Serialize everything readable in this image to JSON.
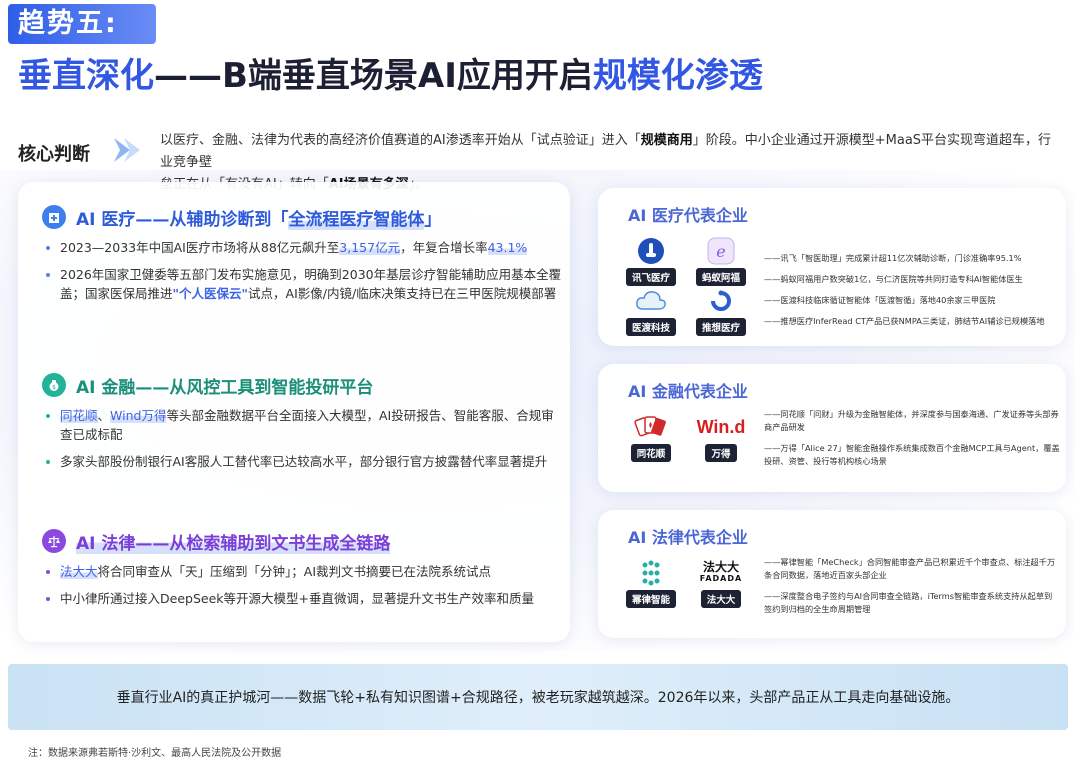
{
  "badge": "趋势五:",
  "headline": {
    "part1": "垂直深化",
    "part2": "——B端垂直场景AI应用开启",
    "part3": "规模化渗透"
  },
  "core": {
    "label": "核心判断",
    "line1_a": "以医疗、金融、法律为代表的高经济价值赛道的AI渗透率开始从「试点验证」进入「",
    "line1_b": "规模商用",
    "line1_c": "」阶段。中小企业通过开源模型+MaaS平台实现弯道超车，行业竞争壁",
    "line2_a": "垒正在从「有没有AI」转向「",
    "line2_b": "AI场景有多深",
    "line2_c": "」。"
  },
  "medical": {
    "title_a": "AI 医疗——从辅助诊断到「",
    "title_b": "全流程医疗智能体",
    "title_c": "」",
    "b1_a": "2023—2033年中国AI医疗市场将从88亿元飙升至",
    "b1_b": "3,157亿元",
    "b1_c": "，年复合增长率",
    "b1_d": "43.1%",
    "b2_a": "2026年国家卫健委等五部门发布实施意见，明确到2030年基层诊疗智能辅助应用基本全覆盖；国家医保局推进",
    "b2_b": "\"个人医保云\"",
    "b2_c": "试点，AI影像/内镜/临床决策支持已在三甲医院规模部署"
  },
  "finance": {
    "title": "AI 金融——从风控工具到智能投研平台",
    "b1_a": "同花顺",
    "b1_sep": "、",
    "b1_b": "Wind万得",
    "b1_c": "等头部金融数据平台全面接入大模型，AI投研报告、智能客服、合规审查已成标配",
    "b2": "多家头部股份制银行AI客服人工替代率已达较高水平，部分银行官方披露替代率显著提升"
  },
  "legal": {
    "title": "AI 法律——从检索辅助到文书生成全链路",
    "b1_a": "法大大",
    "b1_b": "将合同审查从「天」压缩到「分钟」；AI裁判文书摘要已在法院系统试点",
    "b2": "中小律所通过接入DeepSeek等开源大模型+垂直微调，显著提升文书生产效率和质量"
  },
  "medical_companies": {
    "title": "AI 医疗代表企业",
    "logos": [
      "讯飞医疗",
      "蚂蚁阿福",
      "医渡科技",
      "推想医疗"
    ],
    "lines": [
      "——讯飞「智医助理」完成累计超11亿次辅助诊断，门诊准确率95.1%",
      "——蚂蚁阿福用户数突破1亿，与仁济医院等共同打造专科AI智能体医生",
      "——医渡科技临床循证智能体「医渡智循」落地40余家三甲医院",
      "——推想医疗InferRead CT产品已获NMPA三类证，肺结节AI辅诊已规模落地"
    ]
  },
  "finance_companies": {
    "title": "AI 金融代表企业",
    "logos": [
      "同花顺",
      "万得"
    ],
    "wind_mark": "Win.d",
    "lines": [
      "——同花顺「问财」升级为金融智能体，并深度参与国泰海通、广发证券等头部券商产品研发",
      "——万得「Alice 27」智能金融操作系统集成数百个金融MCP工具与Agent，覆盖投研、资管、投行等机构核心场景"
    ]
  },
  "legal_companies": {
    "title": "AI 法律代表企业",
    "logos": [
      "幂律智能",
      "法大大"
    ],
    "fadada_mark_cn": "法大大",
    "fadada_mark_en": "FADADA",
    "lines": [
      "——幂律智能「MeCheck」合同智能审查产品已积累近千个审查点、标注超千万条合同数据，落地近百家头部企业",
      "——深度整合电子签约与AI合同审查全链路，iTerms智能审查系统支持从起草到签约到归档的全生命周期管理"
    ]
  },
  "bottom": "垂直行业AI的真正护城河——数据飞轮+私有知识图谱+合规路径，被老玩家越筑越深。2026年以来，头部产品正从工具走向基础设施。",
  "footnote": "注：数据来源弗若斯特·沙利文、最高人民法院及公开数据",
  "colors": {
    "accent_blue": "#3257e3",
    "medical_icon": "#3e7ff0",
    "finance_icon": "#22b39a",
    "legal_icon": "#8a49e0",
    "finance_title": "#1a8f7a",
    "legal_title": "#7b3fd8"
  }
}
